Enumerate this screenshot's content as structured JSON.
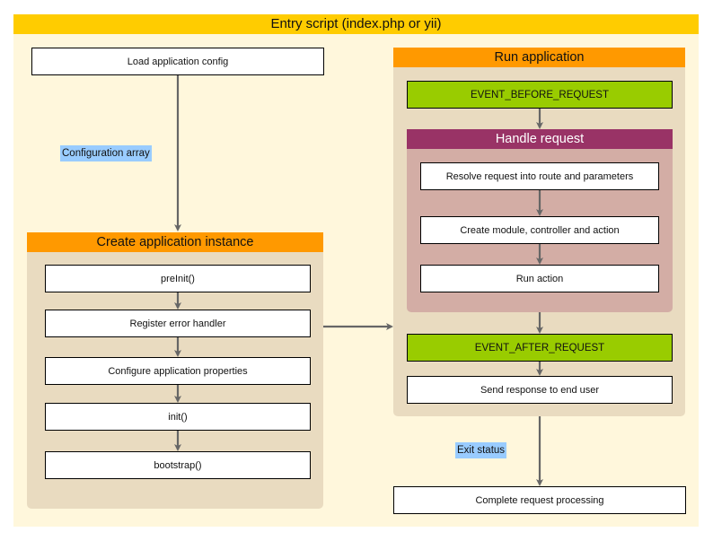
{
  "diagram": {
    "title": "Entry script (index.php or yii)",
    "load_config": "Load application config",
    "config_label": "Configuration array",
    "create_app": {
      "title": "Create application instance",
      "steps": [
        "preInit()",
        "Register error handler",
        "Configure application properties",
        "init()",
        "bootstrap()"
      ]
    },
    "run_app": {
      "title": "Run application",
      "event_before": "EVENT_BEFORE_REQUEST",
      "handle_request": {
        "title": "Handle request",
        "steps": [
          "Resolve request into route and parameters",
          "Create module, controller and action",
          "Run action"
        ]
      },
      "event_after": "EVENT_AFTER_REQUEST",
      "send_response": "Send response to end user"
    },
    "exit_label": "Exit status",
    "complete": "Complete request processing"
  },
  "colors": {
    "outer_header": "#ffcc00",
    "outer_bg": "#fff7dc",
    "section_header": "#ff9900",
    "section_bg": "#e9dbc0",
    "handle_header": "#993366",
    "handle_bg": "#d3ada5",
    "event_box": "#99cc00",
    "label_bg": "#99ccff",
    "arrow": "#666666"
  }
}
